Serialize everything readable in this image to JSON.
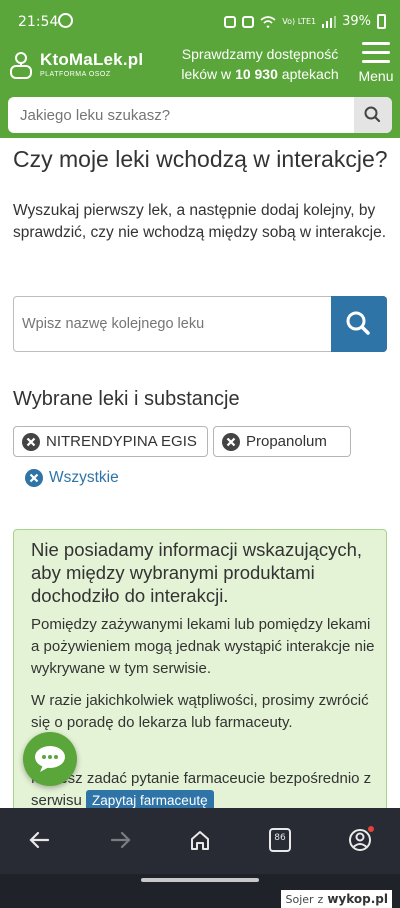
{
  "status_bar": {
    "time": "21:54",
    "battery": "39%",
    "icons": [
      "whatsapp-icon",
      "alarm-icon",
      "mute-icon",
      "wifi-icon",
      "volte-icon",
      "signal-icon",
      "battery-icon"
    ]
  },
  "header": {
    "logo_name": "KtoMaLek.pl",
    "logo_sub": "PLATFORMA OSOZ",
    "tagline_line1": "Sprawdzamy dostępność",
    "tagline_prefix": "leków w ",
    "tagline_count": "10 930",
    "tagline_suffix": " aptekach",
    "menu_label": "Menu"
  },
  "search": {
    "placeholder": "Jakiego leku szukasz?"
  },
  "main": {
    "title": "Czy moje leki wchodzą w interakcje?",
    "intro": "Wyszukaj pierwszy lek, a następnie dodaj kolejny, by sprawdzić, czy nie wchodzą między sobą w interakcje.",
    "add_placeholder": "Wpisz nazwę kolejnego leku",
    "selected_heading": "Wybrane leki i substancje",
    "chips": [
      "NITRENDYPINA EGIS",
      "Propanolum"
    ],
    "remove_all_label": "Wszystkie"
  },
  "info": {
    "lead": "Nie posiadamy informacji wskazujących, aby między wybranymi produktami dochodziło do interakcji.",
    "p1": "Pomiędzy zażywanymi lekami lub pomiędzy lekami a pożywieniem mogą jednak wystąpić interakcje nie wykrywane w tym serwisie.",
    "p2": "W razie jakichkolwiek wątpliwości, prosimy zwrócić się o poradę do lekarza lub farmaceuty.",
    "p3": "Możesz zadać pytanie farmaceucie bezpośrednio z serwisu",
    "ask_button": "Zapytaj farmaceutę"
  },
  "browser_nav": {
    "tab_count": "86"
  },
  "watermark": {
    "author": "Sojer",
    "joiner": "z",
    "site": "wykop.pl"
  },
  "colors": {
    "brand_green": "#5aa63a",
    "accent_blue": "#2f74a7",
    "info_bg": "#e4f3d6",
    "nav_bg": "#282b33"
  }
}
